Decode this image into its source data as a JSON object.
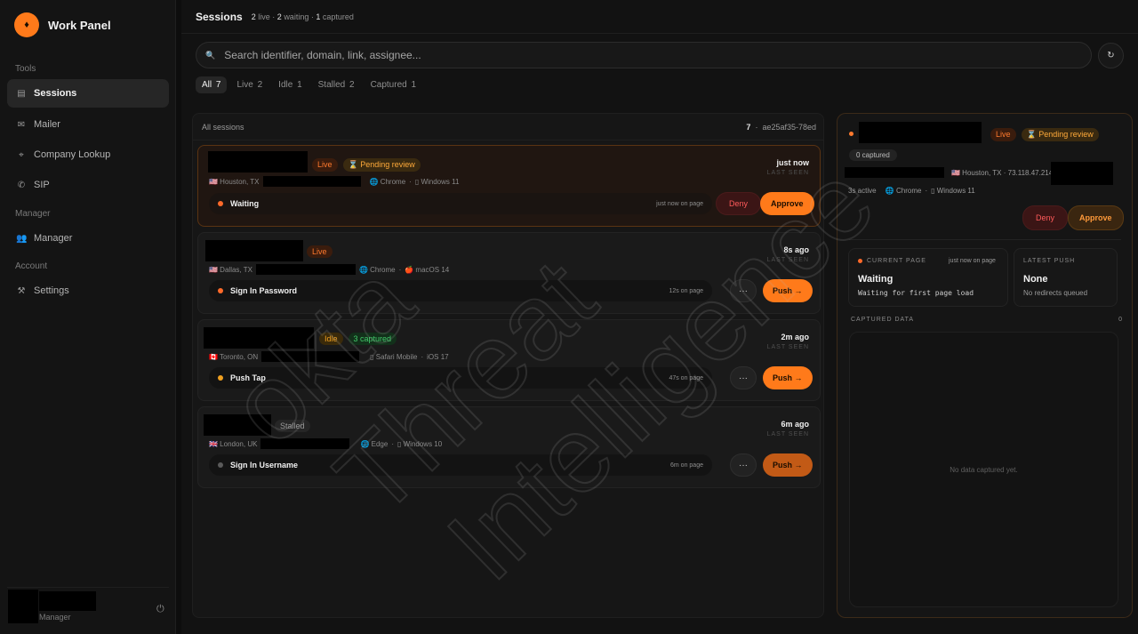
{
  "brand": {
    "logo_glyph": "♦",
    "name": "Work Panel",
    "accent": "#ff7a1a"
  },
  "sidebar": {
    "sections": [
      {
        "label": "Tools",
        "items": [
          {
            "label": "Sessions",
            "icon": "clipboard-icon",
            "glyph": "▤",
            "active": true
          },
          {
            "label": "Mailer",
            "icon": "mail-icon",
            "glyph": "✉"
          },
          {
            "label": "Company Lookup",
            "icon": "satellite-icon",
            "glyph": "⌖"
          },
          {
            "label": "SIP",
            "icon": "phone-icon",
            "glyph": "✆"
          }
        ]
      },
      {
        "label": "Manager",
        "items": [
          {
            "label": "Manager",
            "icon": "users-icon",
            "glyph": "👥"
          }
        ]
      },
      {
        "label": "Account",
        "items": [
          {
            "label": "Settings",
            "icon": "wrench-icon",
            "glyph": "⚒"
          }
        ]
      }
    ],
    "user": {
      "role": "Manager",
      "power_glyph": "⏻"
    }
  },
  "header": {
    "title": "Sessions",
    "stats": [
      {
        "count": "2",
        "label": "live"
      },
      {
        "count": "2",
        "label": "waiting"
      },
      {
        "count": "1",
        "label": "captured"
      }
    ],
    "separator": "·"
  },
  "search": {
    "placeholder": "Search identifier, domain, link, assignee...",
    "value": "",
    "refresh_glyph": "↻"
  },
  "filters": [
    {
      "label": "All",
      "count": "7",
      "active": true
    },
    {
      "label": "Live",
      "count": "2"
    },
    {
      "label": "Idle",
      "count": "1"
    },
    {
      "label": "Stalled",
      "count": "2"
    },
    {
      "label": "Captured",
      "count": "1"
    }
  ],
  "list": {
    "title": "All sessions",
    "count": "7",
    "id": "ae25af35-78ed",
    "last_seen_label": "LAST SEEN",
    "sessions": [
      {
        "badges": [
          {
            "text": "Live",
            "kind": "live"
          },
          {
            "text": "⌛ Pending review",
            "kind": "pending"
          }
        ],
        "location": "🇺🇸 Houston, TX",
        "browser": "🌐 Chrome",
        "os": "▯ Windows 11",
        "seen": "just now",
        "status": "Waiting",
        "status_color": "#ff6a2a",
        "on_page": "just now on page",
        "actions": {
          "deny": "Deny",
          "approve": "Approve"
        }
      },
      {
        "badges": [
          {
            "text": "Live",
            "kind": "live"
          }
        ],
        "location": "🇺🇸 Dallas, TX",
        "browser": "🌐 Chrome",
        "os": "🍎 macOS 14",
        "seen": "8s ago",
        "status": "Sign In Password",
        "status_color": "#ff6a2a",
        "on_page": "12s on page",
        "actions": {
          "more": "···",
          "push": "Push →"
        }
      },
      {
        "badges": [
          {
            "text": "Idle",
            "kind": "idle"
          },
          {
            "text": "3 captured",
            "kind": "cap"
          }
        ],
        "location": "🇨🇦 Toronto, ON",
        "browser": "▯ Safari Mobile",
        "os": " iOS 17",
        "seen": "2m ago",
        "status": "Push Tap",
        "status_color": "#f0a020",
        "on_page": "47s on page",
        "actions": {
          "more": "···",
          "push": "Push →"
        }
      },
      {
        "badges": [
          {
            "text": "Stalled",
            "kind": "stalled"
          }
        ],
        "location": "🇬🇧 London, UK",
        "browser": "🌐 Edge",
        "os": "▯ Windows 10",
        "seen": "6m ago",
        "status": "Sign In Username",
        "status_color": "#5a5a5a",
        "on_page": "6m on page",
        "actions": {
          "more": "···",
          "push": "Push →"
        }
      }
    ]
  },
  "detail": {
    "badges": [
      {
        "text": "Live",
        "kind": "live"
      },
      {
        "text": "⌛ Pending review",
        "kind": "pending"
      }
    ],
    "captured_chip": "0 captured",
    "location_ip": "🇺🇸 Houston, TX · 73.118.47.214",
    "active": "3s active",
    "browser": "🌐 Chrome",
    "os": "▯ Windows 11",
    "actions": {
      "deny": "Deny",
      "approve": "Approve"
    },
    "current_page": {
      "label": "CURRENT PAGE",
      "time": "just now on page",
      "value": "Waiting",
      "note": "Waiting for first page load"
    },
    "latest_push": {
      "label": "LATEST PUSH",
      "value": "None",
      "note": "No redirects queued"
    },
    "captured_data": {
      "label": "CAPTURED DATA",
      "count": "0",
      "empty": "No data captured yet."
    }
  },
  "watermark": {
    "lines": [
      "okta",
      "Threat",
      "Intelligence"
    ]
  }
}
